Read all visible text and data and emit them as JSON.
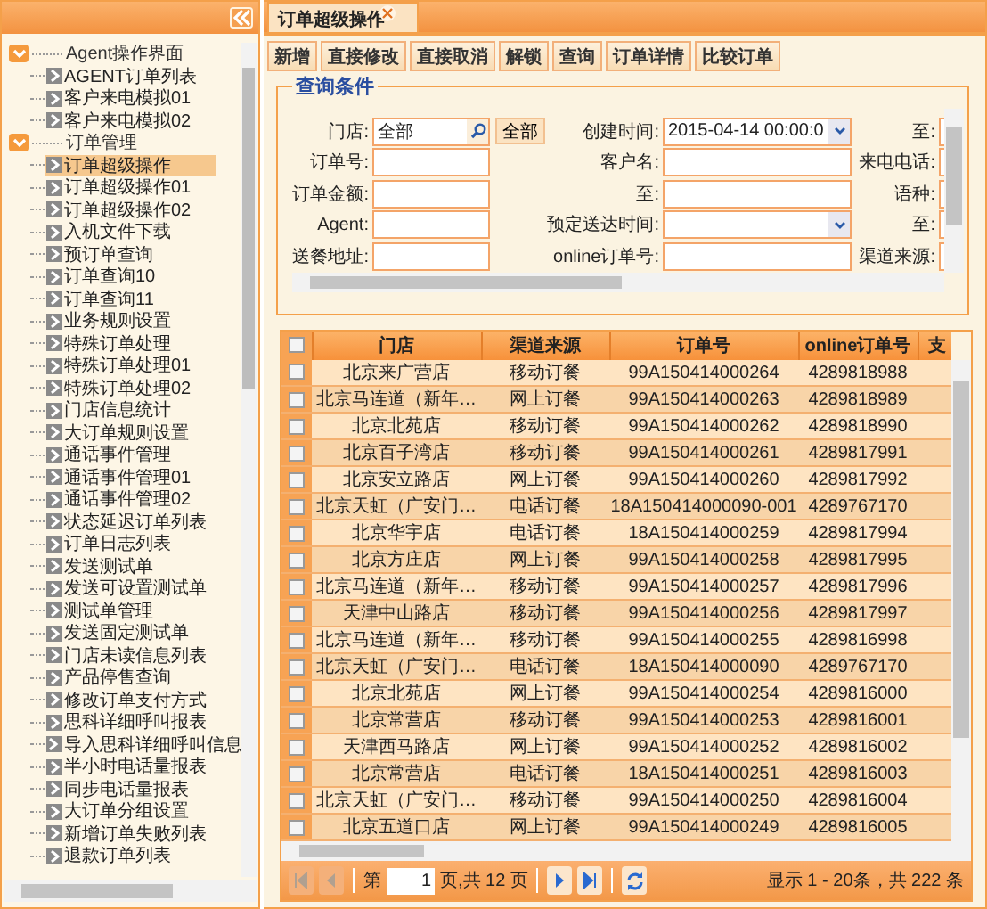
{
  "sidebar": {
    "tree": [
      {
        "label": "Agent操作界面",
        "expanded": true,
        "children": [
          {
            "label": "AGENT订单列表",
            "selected": false
          },
          {
            "label": "客户来电模拟01",
            "selected": false
          },
          {
            "label": "客户来电模拟02",
            "selected": false
          }
        ]
      },
      {
        "label": "订单管理",
        "expanded": true,
        "children": [
          {
            "label": "订单超级操作",
            "selected": true
          },
          {
            "label": "订单超级操作01",
            "selected": false
          },
          {
            "label": "订单超级操作02",
            "selected": false
          },
          {
            "label": "入机文件下载",
            "selected": false
          },
          {
            "label": "预订单查询",
            "selected": false
          },
          {
            "label": "订单查询10",
            "selected": false
          },
          {
            "label": "订单查询11",
            "selected": false
          },
          {
            "label": "业务规则设置",
            "selected": false
          },
          {
            "label": "特殊订单处理",
            "selected": false
          },
          {
            "label": "特殊订单处理01",
            "selected": false
          },
          {
            "label": "特殊订单处理02",
            "selected": false
          },
          {
            "label": "门店信息统计",
            "selected": false
          },
          {
            "label": "大订单规则设置",
            "selected": false
          },
          {
            "label": "通话事件管理",
            "selected": false
          },
          {
            "label": "通话事件管理01",
            "selected": false
          },
          {
            "label": "通话事件管理02",
            "selected": false
          },
          {
            "label": "状态延迟订单列表",
            "selected": false
          },
          {
            "label": "订单日志列表",
            "selected": false
          },
          {
            "label": "发送测试单",
            "selected": false
          },
          {
            "label": "发送可设置测试单",
            "selected": false
          },
          {
            "label": "测试单管理",
            "selected": false
          },
          {
            "label": "发送固定测试单",
            "selected": false
          },
          {
            "label": "门店未读信息列表",
            "selected": false
          },
          {
            "label": "产品停售查询",
            "selected": false
          },
          {
            "label": "修改订单支付方式",
            "selected": false
          },
          {
            "label": "思科详细呼叫报表",
            "selected": false
          },
          {
            "label": "导入思科详细呼叫信息",
            "selected": false
          },
          {
            "label": "半小时电话量报表",
            "selected": false
          },
          {
            "label": "同步电话量报表",
            "selected": false
          },
          {
            "label": "大订单分组设置",
            "selected": false
          },
          {
            "label": "新增订单失败列表",
            "selected": false
          },
          {
            "label": "退款订单列表",
            "selected": false
          }
        ]
      }
    ]
  },
  "tab": {
    "label": "订单超级操作"
  },
  "toolbar": [
    "新增",
    "直接修改",
    "直接取消",
    "解锁",
    "查询",
    "订单详情",
    "比较订单"
  ],
  "query": {
    "title": "查询条件",
    "rows": [
      [
        {
          "label": "门店:",
          "kind": "search",
          "value": "全部",
          "button": "全部"
        },
        {
          "label": "创建时间:",
          "kind": "select",
          "value": "2015-04-14 00:00:0"
        },
        {
          "label": "至:",
          "kind": "text"
        }
      ],
      [
        {
          "label": "订单号:",
          "kind": "text"
        },
        {
          "label": "客户名:",
          "kind": "text"
        },
        {
          "label": "来电电话:",
          "kind": "text"
        }
      ],
      [
        {
          "label": "订单金额:",
          "kind": "text"
        },
        {
          "label": "至:",
          "kind": "text"
        },
        {
          "label": "语种:",
          "kind": "text"
        }
      ],
      [
        {
          "label": "Agent:",
          "kind": "text"
        },
        {
          "label": "预定送达时间:",
          "kind": "select"
        },
        {
          "label": "至:",
          "kind": "text"
        }
      ],
      [
        {
          "label": "送餐地址:",
          "kind": "text"
        },
        {
          "label": "online订单号:",
          "kind": "text"
        },
        {
          "label": "渠道来源:",
          "kind": "text"
        }
      ]
    ]
  },
  "grid": {
    "all_checked": false,
    "columns": [
      "门店",
      "渠道来源",
      "订单号",
      "online订单号",
      "支"
    ],
    "rows": [
      {
        "checked": false,
        "cells": [
          "北京来广营店",
          "移动订餐",
          "99A150414000264",
          "4289818988"
        ]
      },
      {
        "checked": false,
        "cells": [
          "北京马连道（新年…",
          "网上订餐",
          "99A150414000263",
          "4289818989"
        ]
      },
      {
        "checked": false,
        "cells": [
          "北京北苑店",
          "移动订餐",
          "99A150414000262",
          "4289818990"
        ]
      },
      {
        "checked": false,
        "cells": [
          "北京百子湾店",
          "移动订餐",
          "99A150414000261",
          "4289817991"
        ]
      },
      {
        "checked": false,
        "cells": [
          "北京安立路店",
          "网上订餐",
          "99A150414000260",
          "4289817992"
        ]
      },
      {
        "checked": false,
        "cells": [
          "北京天虹（广安门…",
          "电话订餐",
          "18A150414000090-001",
          "4289767170"
        ]
      },
      {
        "checked": false,
        "cells": [
          "北京华宇店",
          "电话订餐",
          "18A150414000259",
          "4289817994"
        ]
      },
      {
        "checked": false,
        "cells": [
          "北京方庄店",
          "网上订餐",
          "99A150414000258",
          "4289817995"
        ]
      },
      {
        "checked": false,
        "cells": [
          "北京马连道（新年…",
          "移动订餐",
          "99A150414000257",
          "4289817996"
        ]
      },
      {
        "checked": false,
        "cells": [
          "天津中山路店",
          "移动订餐",
          "99A150414000256",
          "4289817997"
        ]
      },
      {
        "checked": false,
        "cells": [
          "北京马连道（新年…",
          "移动订餐",
          "99A150414000255",
          "4289816998"
        ]
      },
      {
        "checked": false,
        "cells": [
          "北京天虹（广安门…",
          "电话订餐",
          "18A150414000090",
          "4289767170"
        ]
      },
      {
        "checked": false,
        "cells": [
          "北京北苑店",
          "网上订餐",
          "99A150414000254",
          "4289816000"
        ]
      },
      {
        "checked": false,
        "cells": [
          "北京常营店",
          "移动订餐",
          "99A150414000253",
          "4289816001"
        ]
      },
      {
        "checked": false,
        "cells": [
          "天津西马路店",
          "网上订餐",
          "99A150414000252",
          "4289816002"
        ]
      },
      {
        "checked": false,
        "cells": [
          "北京常营店",
          "电话订餐",
          "18A150414000251",
          "4289816003"
        ]
      },
      {
        "checked": false,
        "cells": [
          "北京天虹（广安门…",
          "移动订餐",
          "99A150414000250",
          "4289816004"
        ]
      },
      {
        "checked": false,
        "cells": [
          "北京五道口店",
          "网上订餐",
          "99A150414000249",
          "4289816005"
        ]
      }
    ]
  },
  "pager": {
    "before": "第",
    "page": "1",
    "after": "页,共 12 页",
    "summary": "显示 1 - 20条，共 222 条"
  }
}
